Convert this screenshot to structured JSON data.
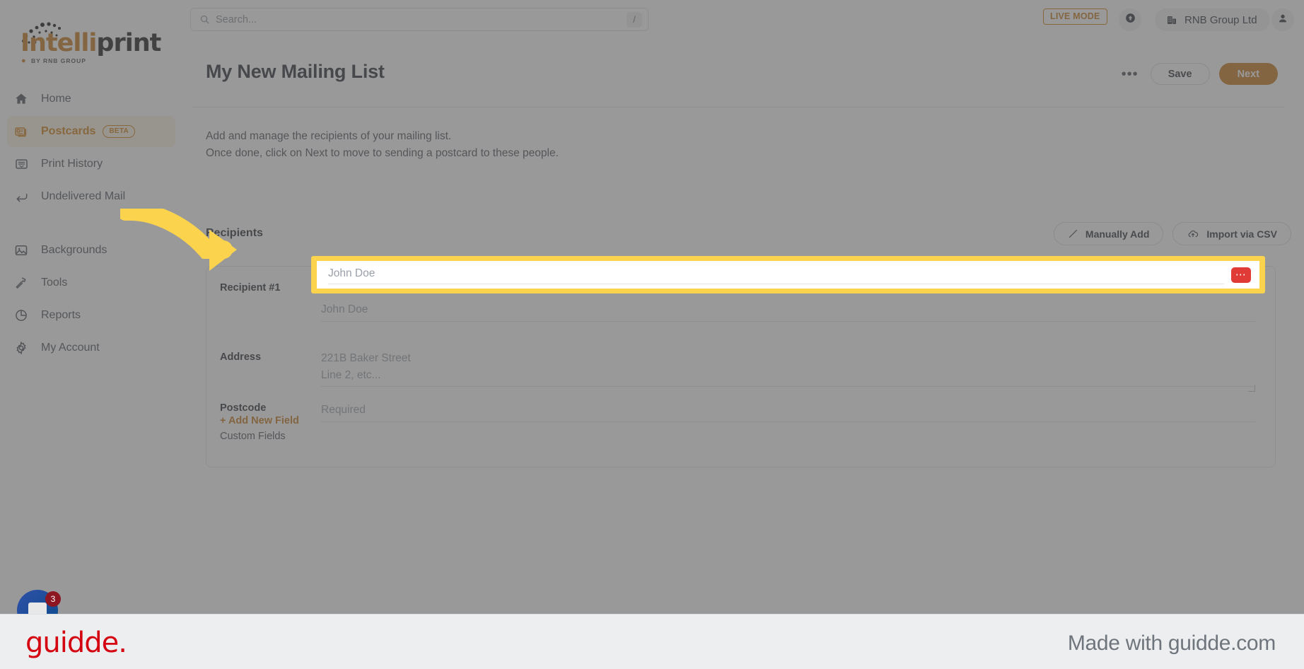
{
  "brand": {
    "logo_intelli": "Intelli",
    "logo_print": "print",
    "logo_subtitle": "BY RNB GROUP"
  },
  "topbar": {
    "search_placeholder": "Search...",
    "search_value": "",
    "search_shortcut": "/",
    "live_mode_label": "LIVE MODE",
    "org_name": "RNB Group Ltd"
  },
  "sidebar": {
    "items": [
      {
        "label": "Home",
        "icon": "home-icon",
        "active": false,
        "badge": ""
      },
      {
        "label": "Postcards",
        "icon": "postcard-icon",
        "active": true,
        "badge": "BETA"
      },
      {
        "label": "Print History",
        "icon": "archive-icon",
        "active": false,
        "badge": ""
      },
      {
        "label": "Undelivered Mail",
        "icon": "return-arrow-icon",
        "active": false,
        "badge": ""
      },
      {
        "label": "Backgrounds",
        "icon": "image-icon",
        "active": false,
        "badge": ""
      },
      {
        "label": "Tools",
        "icon": "hammer-icon",
        "active": false,
        "badge": ""
      },
      {
        "label": "Reports",
        "icon": "pie-chart-icon",
        "active": false,
        "badge": ""
      },
      {
        "label": "My Account",
        "icon": "gear-icon",
        "active": false,
        "badge": ""
      }
    ]
  },
  "chat": {
    "unread_count": "3"
  },
  "page": {
    "title": "My New Mailing List",
    "more_label": "•••",
    "save_label": "Save",
    "next_label": "Next",
    "description_line1": "Add and manage the recipients of your mailing list.",
    "description_line2": "Once done, click on Next to move to sending a postcard to these people."
  },
  "recipients": {
    "section_title": "Recipients",
    "manually_add_label": "Manually Add",
    "import_csv_label": "Import via CSV",
    "card": {
      "heading": "Recipient #1",
      "name_label": "",
      "name_value": "",
      "name_placeholder": "John Doe",
      "address_label": "Address",
      "address_value": "",
      "address_placeholder": "221B Baker Street\nLine 2, etc...",
      "postcode_label": "Postcode",
      "postcode_value": "",
      "postcode_placeholder": "Required",
      "custom_fields_label": "Custom Fields",
      "add_new_field_label": "+ Add New Field"
    }
  },
  "footer": {
    "logo": "guidde.",
    "made_with": "Made with guidde.com"
  },
  "colors": {
    "accent": "#c4761a",
    "highlight": "#fcd34d",
    "guidde_red": "#d40511",
    "password_badge": "#e03b36"
  }
}
